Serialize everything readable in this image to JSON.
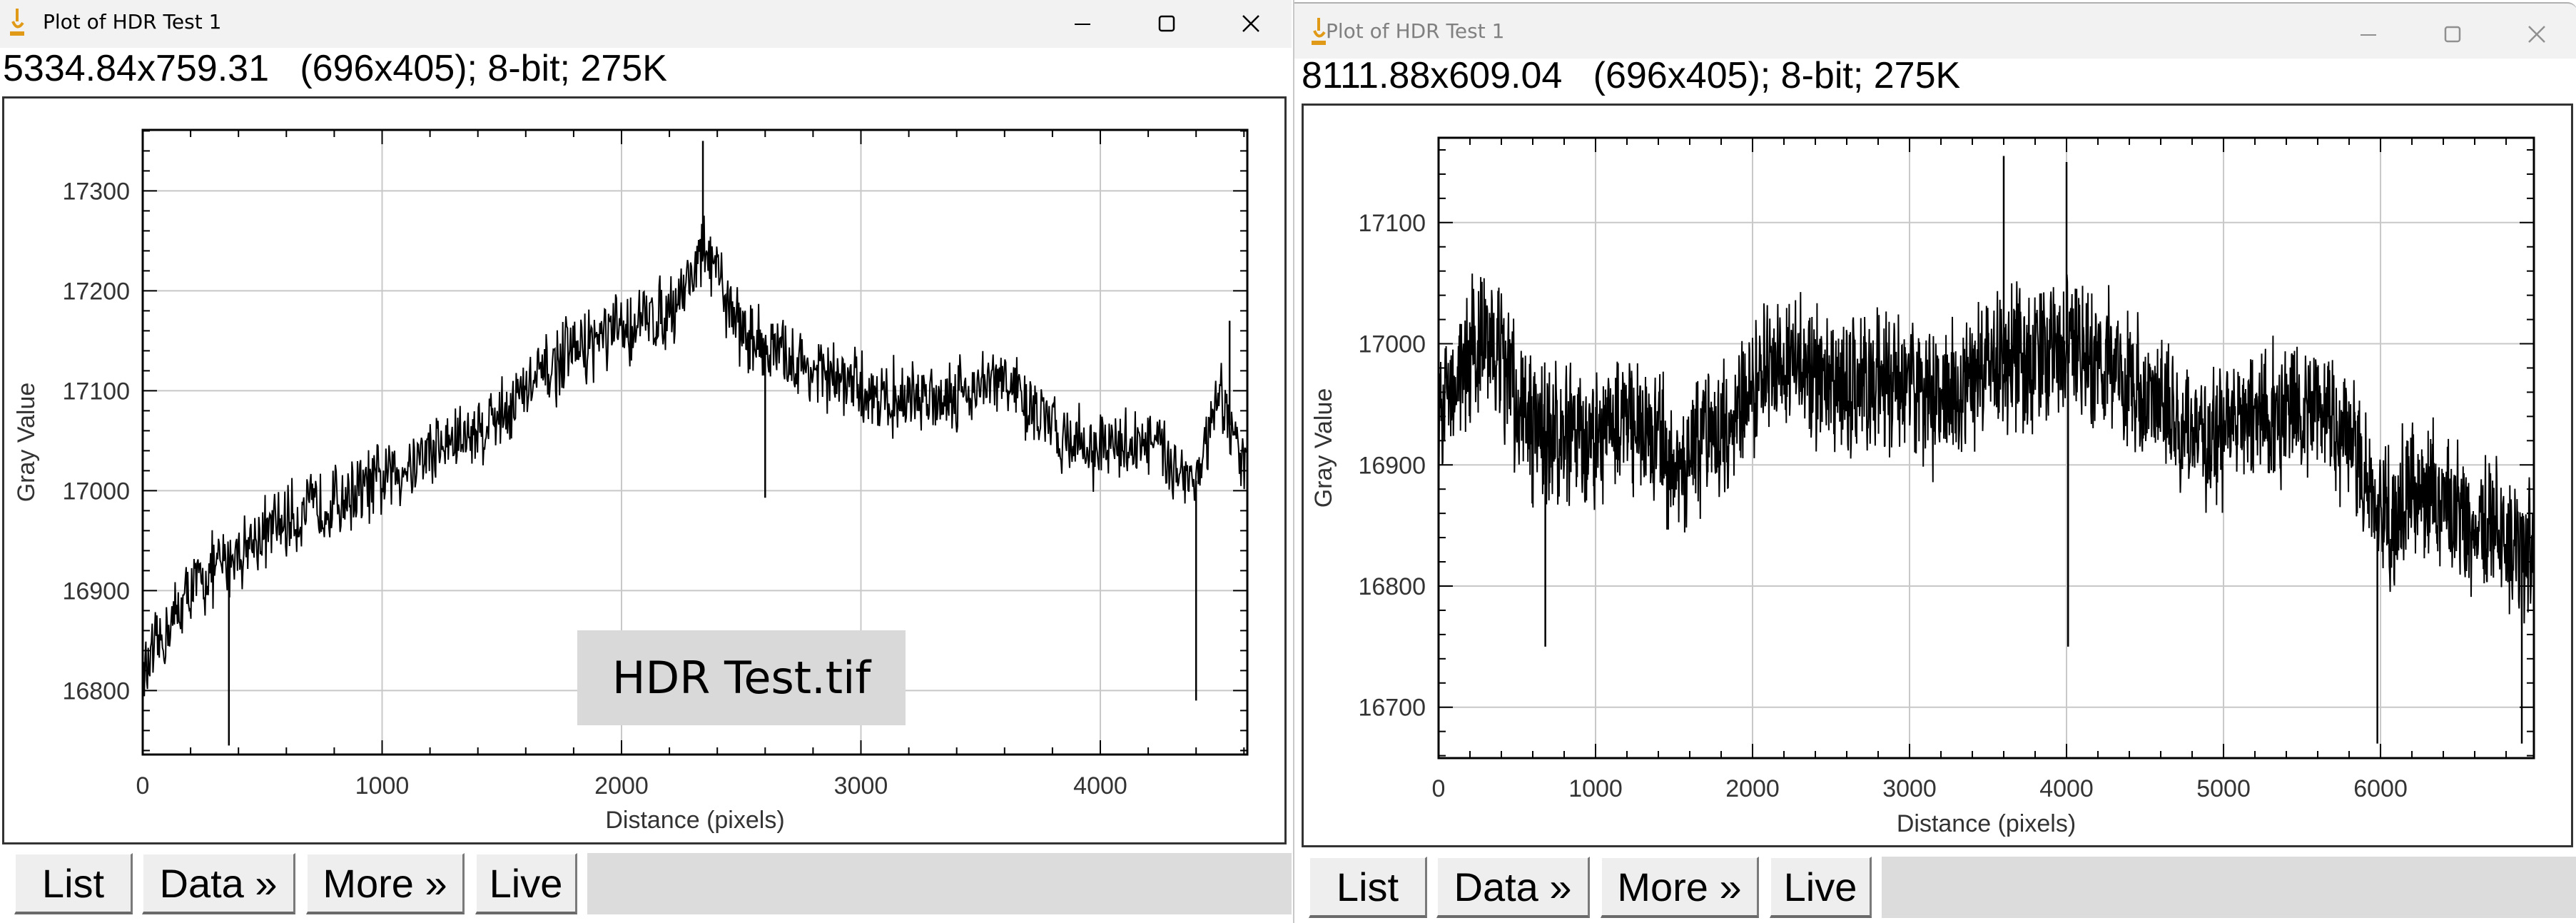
{
  "windows": [
    {
      "id": "left",
      "title": "Plot of HDR Test 1",
      "active": true,
      "info_line": "5334.84x759.31   (696x405); 8-bit; 275K",
      "buttons": [
        "List",
        "Data »",
        "More »",
        "Live"
      ],
      "annotation": "HDR Test.tif",
      "controls": {
        "minimize": "minimize-icon",
        "maximize": "maximize-icon",
        "close": "close-icon"
      }
    },
    {
      "id": "right",
      "title": "Plot of HDR Test 1",
      "active": false,
      "info_line": "8111.88x609.04   (696x405); 8-bit; 275K",
      "buttons": [
        "List",
        "Data »",
        "More »",
        "Live"
      ],
      "controls": {
        "minimize": "minimize-icon",
        "maximize": "maximize-icon",
        "close": "close-icon"
      }
    }
  ],
  "chart_data": [
    {
      "type": "line",
      "title": "",
      "xlabel": "Distance (pixels)",
      "ylabel": "Gray Value",
      "xlim": [
        0,
        4614
      ],
      "ylim": [
        16736,
        17361
      ],
      "xticks": [
        0,
        1000,
        2000,
        3000,
        4000
      ],
      "xtick_labels": [
        "0",
        "1000",
        "2000",
        "3000",
        "4000"
      ],
      "yticks": [
        16800,
        16900,
        17000,
        17100,
        17200,
        17300
      ],
      "ytick_labels": [
        "16800",
        "16900",
        "17000",
        "17100",
        "17200",
        "17300"
      ],
      "x_minor_step": 200,
      "y_minor_step": 20,
      "grid": true,
      "annotation": {
        "text": "HDR Test.tif",
        "x": 2450,
        "y": 16800
      },
      "noise_amplitude": 45,
      "trend": {
        "x": [
          0,
          100,
          200,
          400,
          600,
          800,
          1000,
          1200,
          1400,
          1500,
          1600,
          1800,
          2000,
          2200,
          2350,
          2500,
          2700,
          2900,
          3000,
          3200,
          3400,
          3600,
          3800,
          4000,
          4200,
          4400,
          4500,
          4614
        ],
        "y": [
          16810,
          16860,
          16900,
          16940,
          16970,
          16990,
          17010,
          17040,
          17060,
          17080,
          17100,
          17140,
          17160,
          17180,
          17240,
          17160,
          17130,
          17110,
          17100,
          17090,
          17100,
          17110,
          17060,
          17040,
          17050,
          17010,
          17090,
          17020
        ]
      },
      "outliers": [
        {
          "x": 360,
          "y": 16745
        },
        {
          "x": 2600,
          "y": 16993
        },
        {
          "x": 2340,
          "y": 17350
        },
        {
          "x": 4400,
          "y": 16790
        },
        {
          "x": 4540,
          "y": 17170
        }
      ]
    },
    {
      "type": "line",
      "title": "",
      "xlabel": "Distance (pixels)",
      "ylabel": "Gray Value",
      "xlim": [
        0,
        6977
      ],
      "ylim": [
        16658,
        17170
      ],
      "xticks": [
        0,
        1000,
        2000,
        3000,
        4000,
        5000,
        6000
      ],
      "xtick_labels": [
        "0",
        "1000",
        "2000",
        "3000",
        "4000",
        "5000",
        "6000"
      ],
      "yticks": [
        16700,
        16800,
        16900,
        17000,
        17100
      ],
      "ytick_labels": [
        "16700",
        "16800",
        "16900",
        "17000",
        "17100"
      ],
      "x_minor_step": 200,
      "y_minor_step": 20,
      "grid": true,
      "noise_amplitude": 70,
      "trend": {
        "x": [
          0,
          300,
          600,
          900,
          1200,
          1500,
          1800,
          2000,
          2300,
          2600,
          2900,
          3200,
          3500,
          3800,
          4000,
          4300,
          4600,
          4900,
          5200,
          5500,
          5800,
          6000,
          6300,
          6600,
          6977
        ],
        "y": [
          16950,
          17010,
          16930,
          16920,
          16940,
          16900,
          16920,
          16970,
          16980,
          16960,
          16970,
          16950,
          16980,
          16990,
          17000,
          16980,
          16950,
          16920,
          16940,
          16940,
          16930,
          16860,
          16880,
          16850,
          16830
        ]
      },
      "outliers": [
        {
          "x": 4000,
          "y": 17150
        },
        {
          "x": 3600,
          "y": 17155
        },
        {
          "x": 4010,
          "y": 16750
        },
        {
          "x": 5980,
          "y": 16670
        },
        {
          "x": 6900,
          "y": 16670
        },
        {
          "x": 680,
          "y": 16750
        }
      ]
    }
  ]
}
